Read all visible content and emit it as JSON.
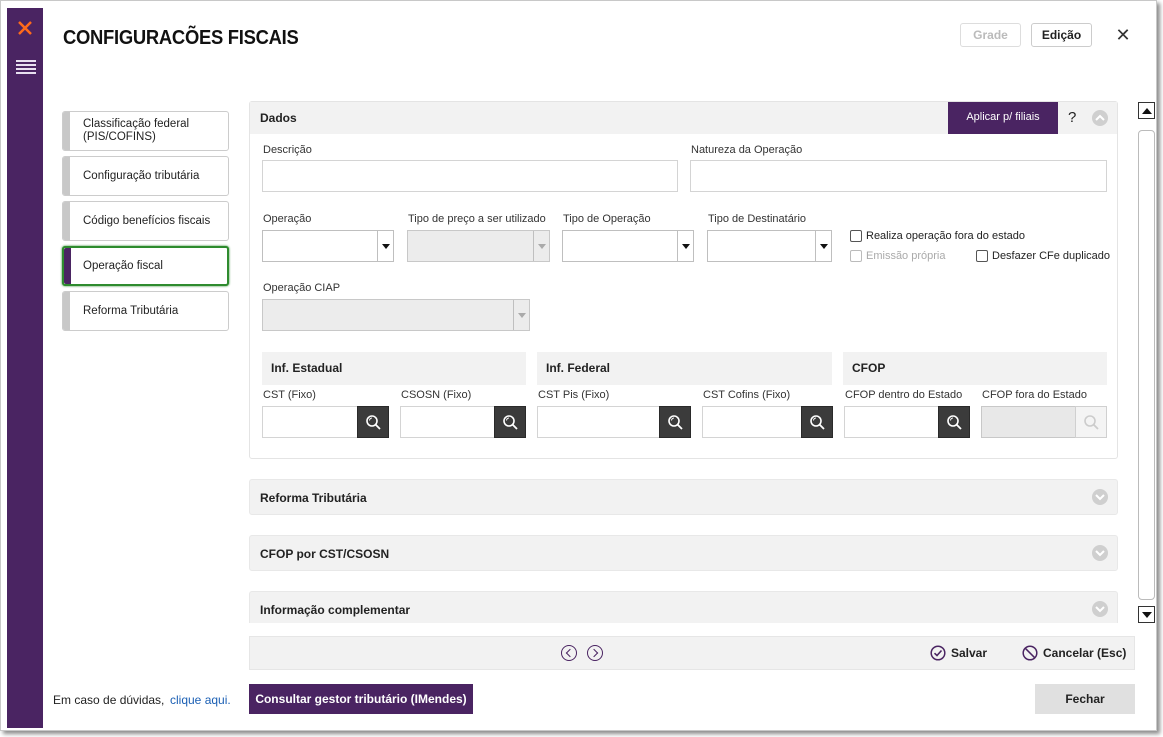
{
  "header": {
    "title": "CONFIGURACÕES FISCAIS",
    "mode_grade": "Grade",
    "mode_edicao": "Edição",
    "close": "✕"
  },
  "sidebar": {
    "items": [
      {
        "label": "Classificação federal (PIS/COFINS)",
        "active": false
      },
      {
        "label": "Configuração tributária",
        "active": false
      },
      {
        "label": "Código benefícios fiscais",
        "active": false
      },
      {
        "label": "Operação fiscal",
        "active": true
      },
      {
        "label": "Reforma Tributária",
        "active": false
      }
    ]
  },
  "dados": {
    "title": "Dados",
    "apply_label": "Aplicar p/ filiais",
    "help": "?",
    "descricao_label": "Descrição",
    "descricao_value": "",
    "natureza_label": "Natureza da Operação",
    "natureza_value": "",
    "operacao_label": "Operação",
    "tipo_preco_label": "Tipo de preço a ser utilizado",
    "tipo_operacao_label": "Tipo de Operação",
    "tipo_destinatario_label": "Tipo de Destinatário",
    "realiza_fora_label": "Realiza operação fora do estado",
    "emissao_propria_label": "Emissão própria",
    "desfazer_cfe_label": "Desfazer CFe duplicado",
    "operacao_ciap_label": "Operação CIAP"
  },
  "inf_estadual": {
    "title": "Inf. Estadual",
    "cst_label": "CST (Fixo)",
    "csosn_label": "CSOSN (Fixo)"
  },
  "inf_federal": {
    "title": "Inf. Federal",
    "cst_pis_label": "CST Pis (Fixo)",
    "cst_cofins_label": "CST Cofins (Fixo)"
  },
  "cfop": {
    "title": "CFOP",
    "dentro_label": "CFOP dentro do Estado",
    "fora_label": "CFOP fora do Estado"
  },
  "collapsed_sections": [
    {
      "title": "Reforma Tributária"
    },
    {
      "title": "CFOP por CST/CSOSN"
    },
    {
      "title": "Informação complementar"
    }
  ],
  "footer": {
    "salvar": "Salvar",
    "cancelar": "Cancelar (Esc)"
  },
  "bottom": {
    "help_text": "Em caso de dúvidas,",
    "help_link": "clique aqui.",
    "imendes": "Consultar gestor tributário (IMendes)",
    "fechar": "Fechar"
  },
  "colors": {
    "brand": "#4a2462",
    "active_border": "#2e8b2e"
  }
}
